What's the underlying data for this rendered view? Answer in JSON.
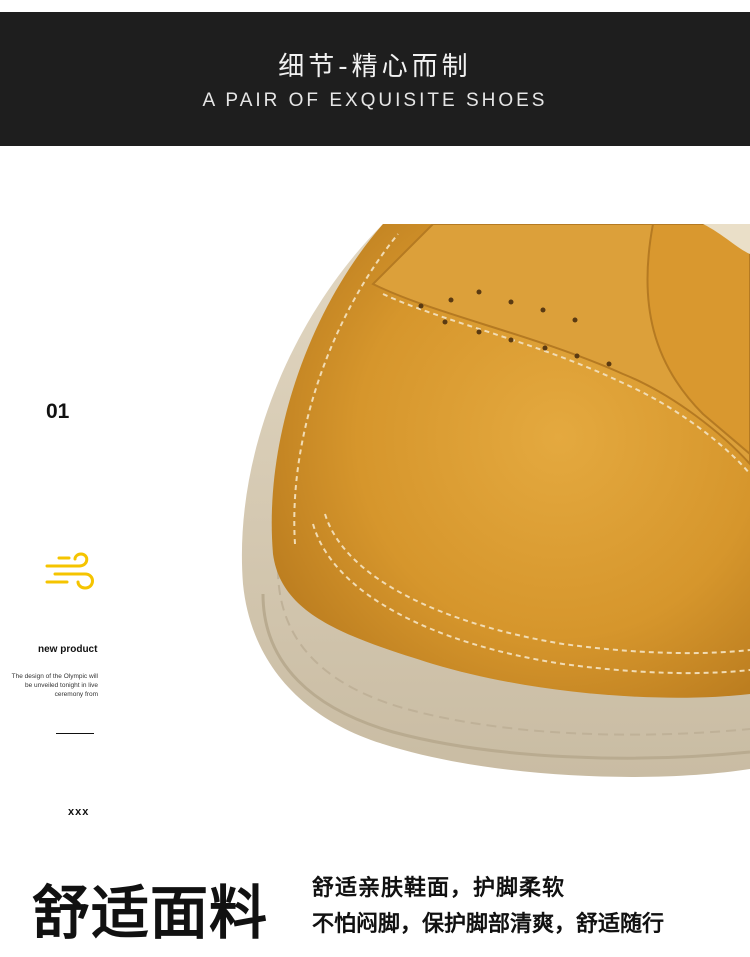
{
  "banner": {
    "title": "细节-精心而制",
    "subtitle": "A PAIR OF EXQUISITE SHOES"
  },
  "side": {
    "number": "01",
    "icon": "wind-icon",
    "accent_color": "#f5c400",
    "label": "new product",
    "description": "The design of the Olympic will be unveiled tonight in live ceremony from",
    "mark": "xxx"
  },
  "feature": {
    "heading": "舒适面料",
    "line1": "舒适亲肤鞋面，护脚柔软",
    "line2": "不怕闷脚，保护脚部清爽，舒适随行"
  },
  "photo": {
    "subject": "shoe-toe-closeup",
    "leather_color": "#d8992e",
    "sole_color": "#d9cdb6"
  }
}
